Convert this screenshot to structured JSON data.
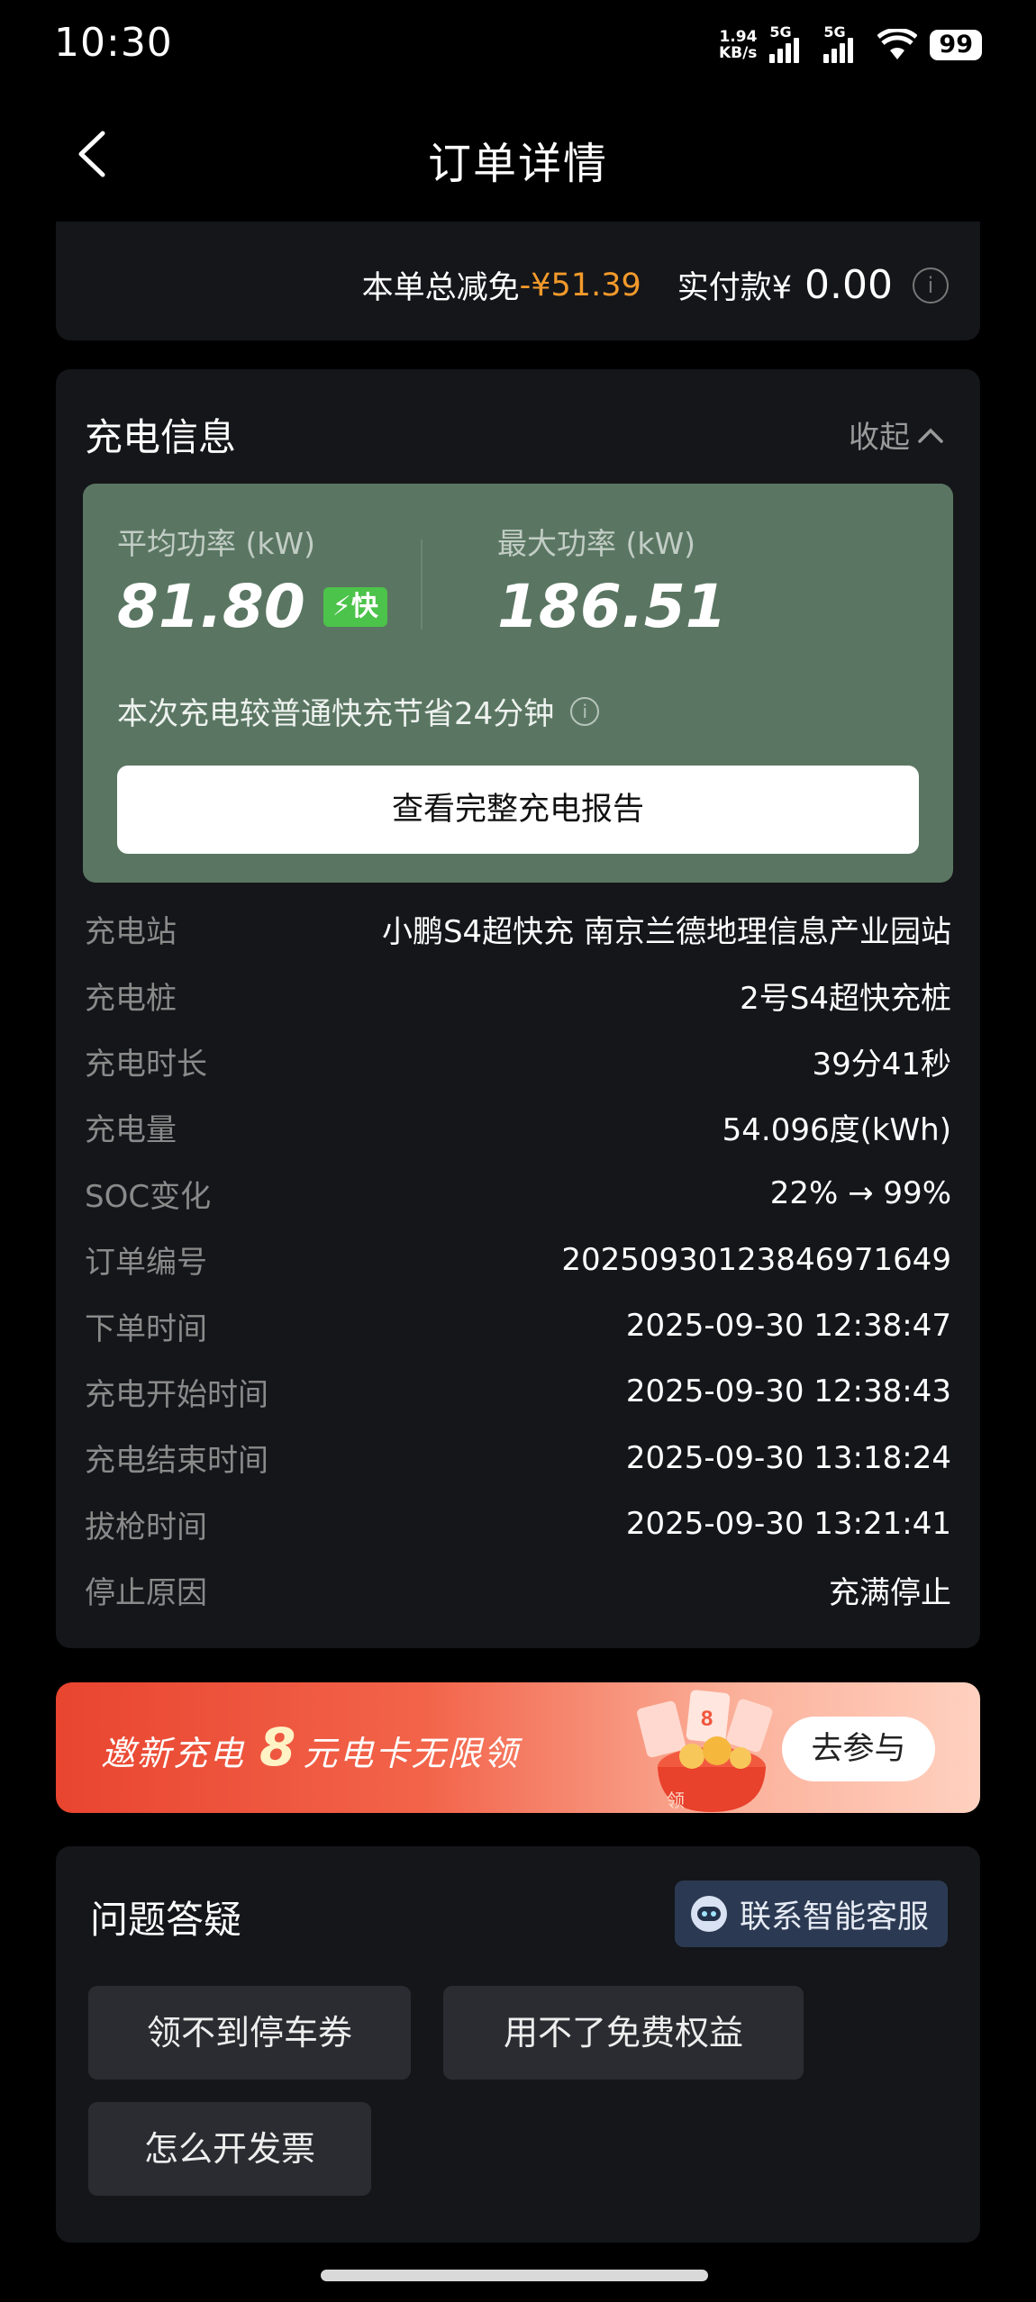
{
  "status_bar": {
    "time": "10:30",
    "net_speed_value": "1.94",
    "net_speed_unit": "KB/s",
    "signal1_label": "5G",
    "signal2_label": "5G",
    "battery": "99"
  },
  "header": {
    "title": "订单详情"
  },
  "payment": {
    "discount_label": "本单总减免",
    "discount_value": "-¥51.39",
    "paid_label": "实付款¥",
    "paid_value": "0.00"
  },
  "charge_info": {
    "title": "充电信息",
    "collapse_label": "收起",
    "avg_power_label": "平均功率 (kW)",
    "avg_power_value": "81.80",
    "fast_badge": "⚡快",
    "max_power_label": "最大功率 (kW)",
    "max_power_value": "186.51",
    "saving_text": "本次充电较普通快充节省24分钟",
    "report_button": "查看完整充电报告",
    "rows": [
      {
        "key": "充电站",
        "value": "小鹏S4超快充 南京兰德地理信息产业园站"
      },
      {
        "key": "充电桩",
        "value": "2号S4超快充桩"
      },
      {
        "key": "充电时长",
        "value": "39分41秒"
      },
      {
        "key": "充电量",
        "value": "54.096度(kWh)"
      },
      {
        "key": "SOC变化",
        "value": "22% → 99%"
      },
      {
        "key": "订单编号",
        "value": "20250930123846971649"
      },
      {
        "key": "下单时间",
        "value": "2025-09-30 12:38:47"
      },
      {
        "key": "充电开始时间",
        "value": "2025-09-30 12:38:43"
      },
      {
        "key": "充电结束时间",
        "value": "2025-09-30 13:18:24"
      },
      {
        "key": "拔枪时间",
        "value": "2025-09-30 13:21:41"
      },
      {
        "key": "停止原因",
        "value": "充满停止"
      }
    ]
  },
  "banner": {
    "text_before": "邀新充电",
    "big_number": "8",
    "text_after": "元电卡无限领",
    "gift_label": "领",
    "button": "去参与"
  },
  "faq": {
    "title": "问题答疑",
    "support_button": "联系智能客服",
    "chips": [
      "领不到停车券",
      "用不了免费权益",
      "怎么开发票"
    ]
  },
  "colors": {
    "background": "#000000",
    "card": "#15161a",
    "accent_green": "#5a7662",
    "discount_orange": "#f39a2b",
    "fast_badge": "#4cc34a"
  }
}
